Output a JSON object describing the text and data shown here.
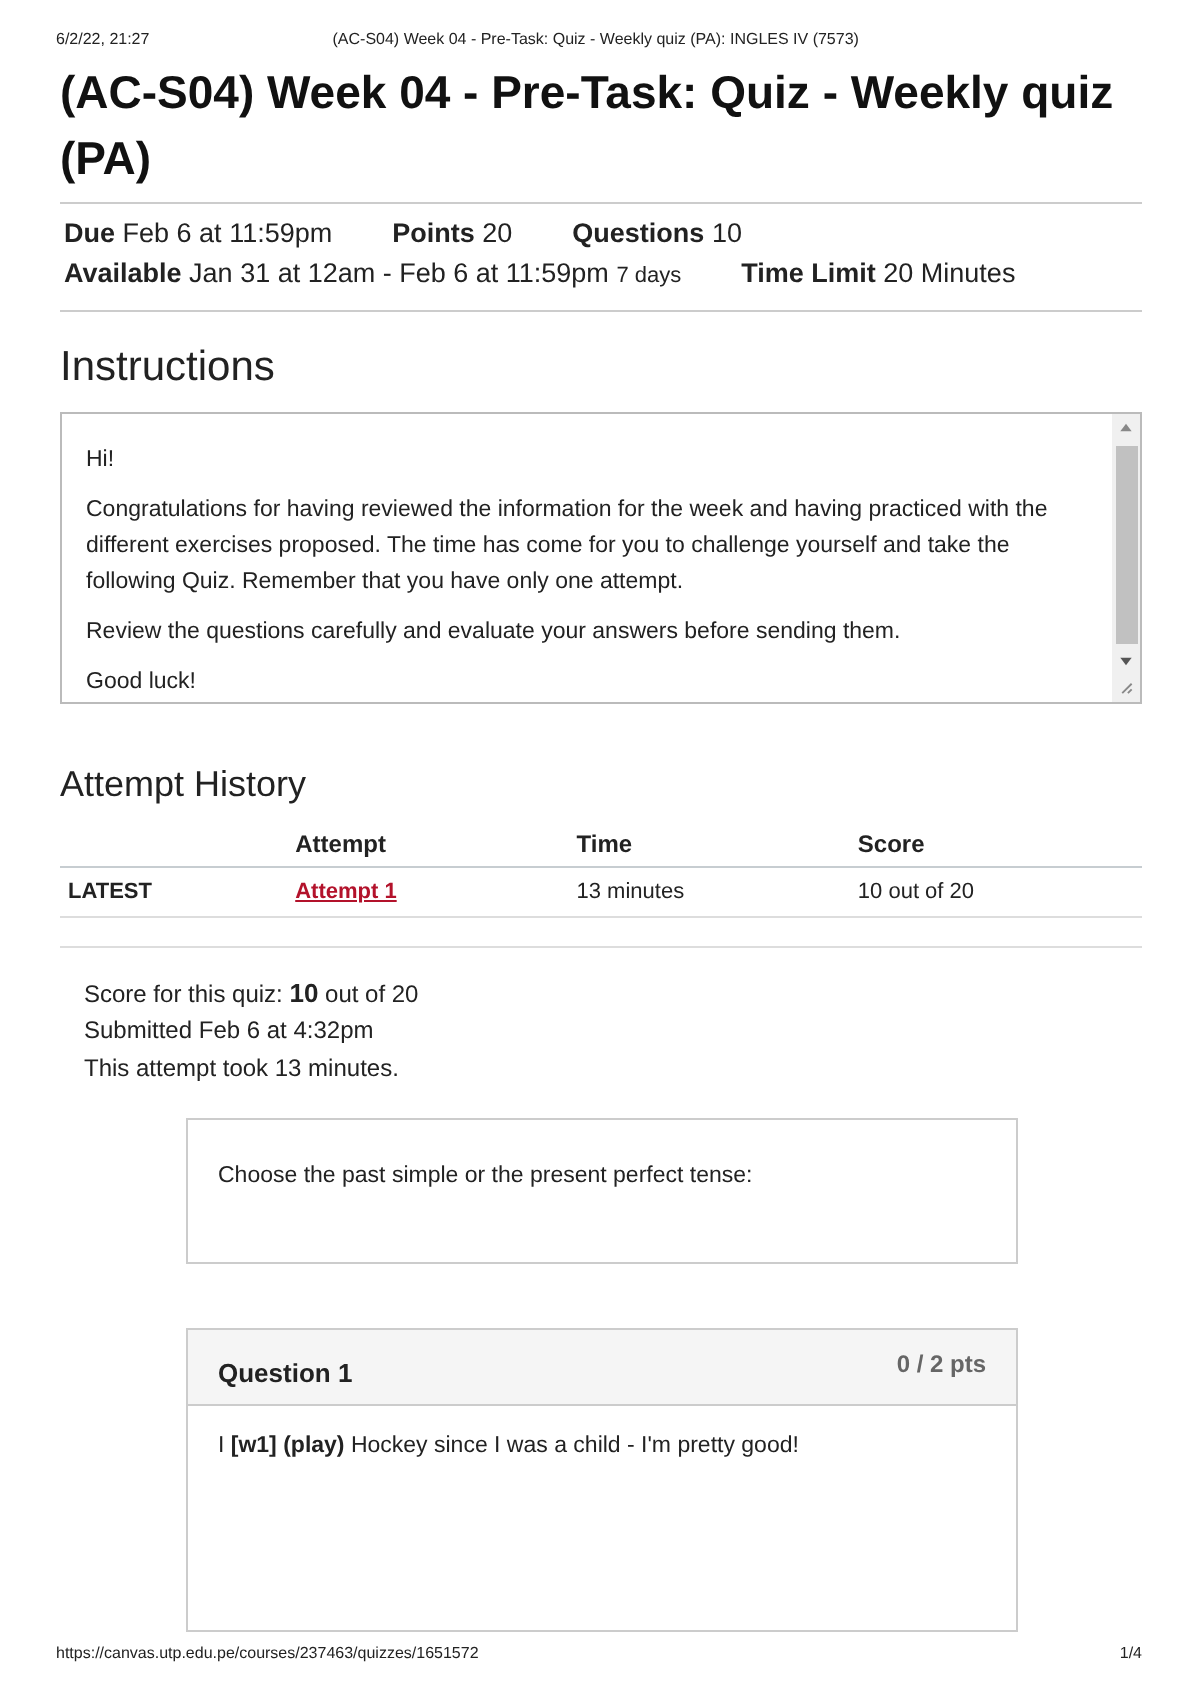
{
  "print_header": {
    "date": "6/2/22, 21:27",
    "title": "(AC-S04) Week 04 - Pre-Task: Quiz - Weekly quiz (PA): INGLES IV (7573)"
  },
  "title": "(AC-S04) Week 04 - Pre-Task: Quiz - Weekly quiz (PA)",
  "details": [
    [
      {
        "label": "Due",
        "value": "Feb 6 at 11:59pm"
      },
      {
        "label": "Points",
        "value": "20"
      },
      {
        "label": "Questions",
        "value": "10"
      }
    ],
    [
      {
        "label": "Available",
        "value": "Jan 31 at 12am - Feb 6 at 11:59pm",
        "note": "7 days"
      },
      {
        "label": "Time Limit",
        "value": "20 Minutes"
      }
    ]
  ],
  "instructions": {
    "heading": "Instructions",
    "paragraphs": [
      "Hi!",
      "Congratulations for having reviewed the information for the week and having practiced with the different exercises proposed. The time has come for you to challenge yourself and take the following Quiz. Remember that you have only one attempt.",
      "Review the questions carefully and evaluate your answers before sending them.",
      "Good luck!"
    ]
  },
  "attempt_history": {
    "heading": "Attempt History",
    "columns": [
      "",
      "Attempt",
      "Time",
      "Score"
    ],
    "rows": [
      {
        "label": "LATEST",
        "attempt": "Attempt 1",
        "time": "13 minutes",
        "score": "10 out of 20"
      }
    ]
  },
  "summary": [
    "Score for this quiz: **10** out of 20",
    "Submitted Feb 6 at 4:32pm",
    "This attempt took 13 minutes."
  ],
  "intro_box": "Choose the past simple or the present perfect tense:",
  "question": {
    "title": "Question 1",
    "points": "0 / 2 pts",
    "text": "I **[w1] (play)** Hockey since I was a child - I'm pretty good!"
  },
  "print_footer": {
    "url": "https://canvas.utp.edu.pe/courses/237463/quizzes/1651572",
    "page": "1/4"
  }
}
